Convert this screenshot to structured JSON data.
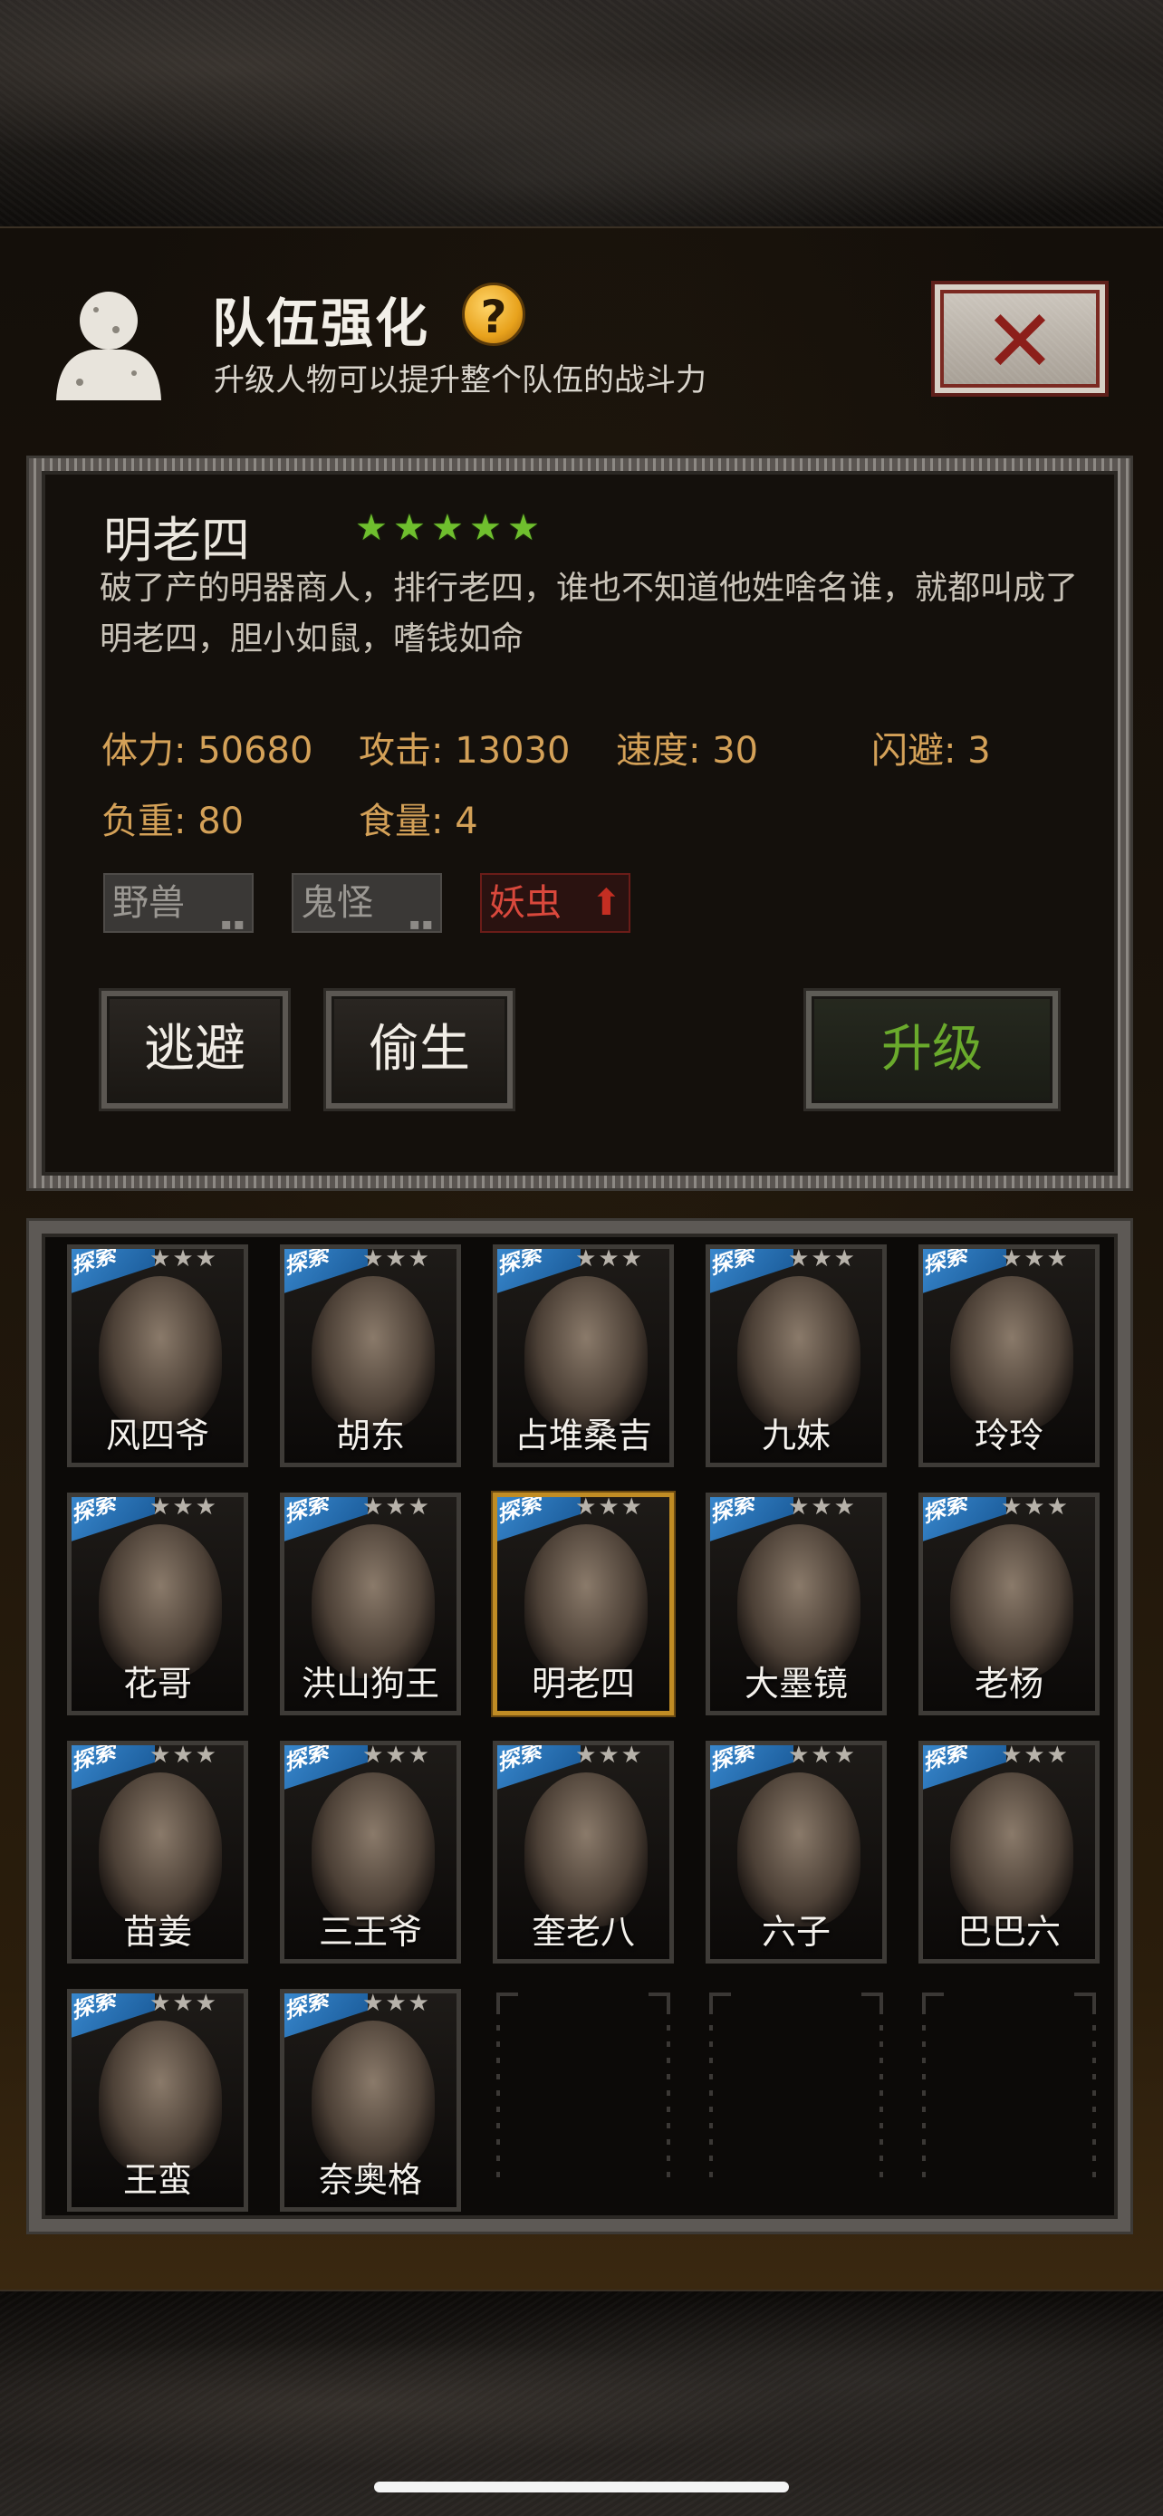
{
  "header": {
    "title": "队伍强化",
    "help_icon": "?",
    "subtitle": "升级人物可以提升整个队伍的战斗力",
    "close_icon": "✕"
  },
  "character": {
    "name": "明老四",
    "stars": 5,
    "description": "破了产的明器商人，排行老四，谁也不知道他姓啥名谁，就都叫成了明老四，胆小如鼠，嗜钱如命",
    "stats": {
      "hp": "体力: 50680",
      "attack": "攻击: 13030",
      "speed": "速度: 30",
      "dodge": "闪避: 3",
      "load": "负重: 80",
      "food": "食量: 4"
    },
    "tags": [
      {
        "label": "野兽",
        "mark": "▪▪"
      },
      {
        "label": "鬼怪",
        "mark": "▪▪"
      },
      {
        "label": "妖虫",
        "mark": "⬆"
      }
    ],
    "buttons": {
      "escape": "逃避",
      "steal_life": "偷生",
      "upgrade": "升级"
    }
  },
  "roster": {
    "ribbon_label": "探索",
    "card_stars": "★★★",
    "members": [
      "风四爷",
      "胡东",
      "占堆桑吉",
      "九妹",
      "玲玲",
      "花哥",
      "洪山狗王",
      "明老四",
      "大墨镜",
      "老杨",
      "苗姜",
      "三王爷",
      "奎老八",
      "六子",
      "巴巴六",
      "王蛮",
      "奈奥格"
    ],
    "selected": "明老四"
  },
  "colors": {
    "accent_gold": "#d4a158",
    "upgrade_green": "#6aaa2c",
    "star_green": "#6fbf2e",
    "ribbon_blue": "#2f7fc6",
    "danger_red": "#c42e22"
  }
}
